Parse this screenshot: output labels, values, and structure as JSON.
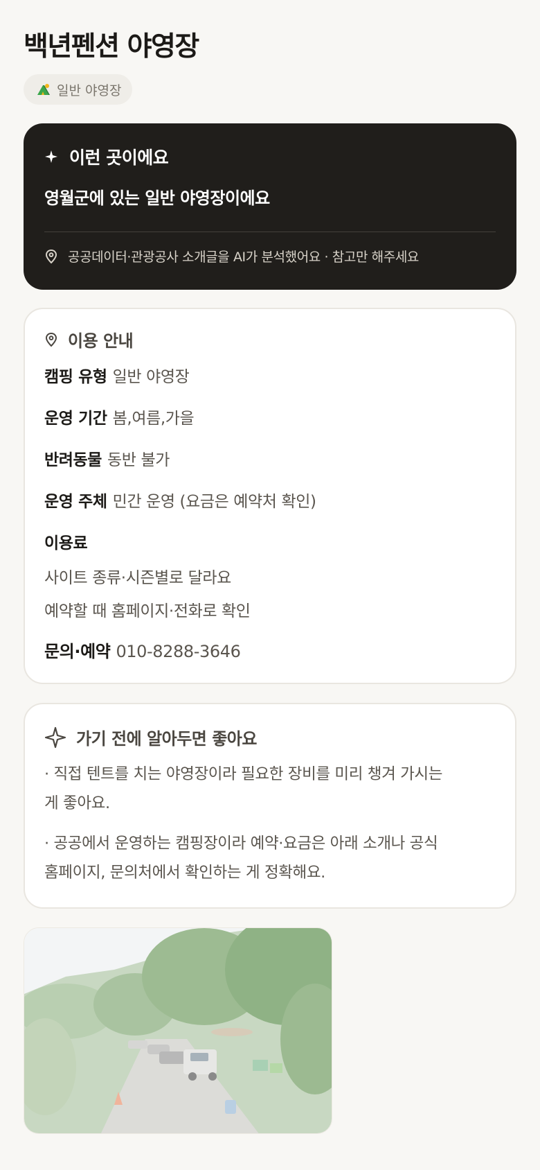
{
  "header": {
    "title": "백년펜션 야영장",
    "tag_label": "일반 야영장",
    "tag_icon": "tent-icon"
  },
  "ai_summary": {
    "heading": "이런 곳이에요",
    "heading_icon": "sparkle-icon",
    "summary": "영월군에 있는 일반 야영장이에요",
    "note": "공공데이터·관광공사 소개글을 AI가 분석했어요 · 참고만 해주세요",
    "note_icon": "location-pin-icon"
  },
  "info": {
    "heading": "이용 안내",
    "heading_icon": "location-pin-icon",
    "camping_type": {
      "label": "캠핑 유형",
      "value": "일반 야영장"
    },
    "season": {
      "label": "운영 기간",
      "value": "봄,여름,가을"
    },
    "pets": {
      "label": "반려동물",
      "value": "동반 불가"
    },
    "operator": {
      "label": "운영 주체",
      "value": "민간 운영 (요금은 예약처 확인)"
    },
    "fee": {
      "label": "이용료",
      "line1": "사이트 종류·시즌별로 달라요",
      "line2": "예약할 때 홈페이지·전화로 확인"
    },
    "contact": {
      "label": "문의·예약",
      "value": "010-8288-3646"
    }
  },
  "tips": {
    "heading": "가기 전에 알아두면 좋아요",
    "heading_icon": "sparkle-outline-icon",
    "tip1_line1": "· 직접 텐트를 치는 야영장이라 필요한 장비를 미리 챙겨 가시는",
    "tip1_line2": "게 좋아요.",
    "tip2_line1": "· 공공에서 운영하는 캠핑장이라 예약·요금은 아래 소개나 공식",
    "tip2_line2": "홈페이지, 문의처에서 확인하는 게 정확해요."
  },
  "colors": {
    "background": "#f8f7f4",
    "dark_card": "#201e1b",
    "card_border": "#e9e6e0",
    "tag_bg": "#efede8",
    "tent_green": "#3aa64a",
    "tent_yellow": "#f2b51c"
  }
}
